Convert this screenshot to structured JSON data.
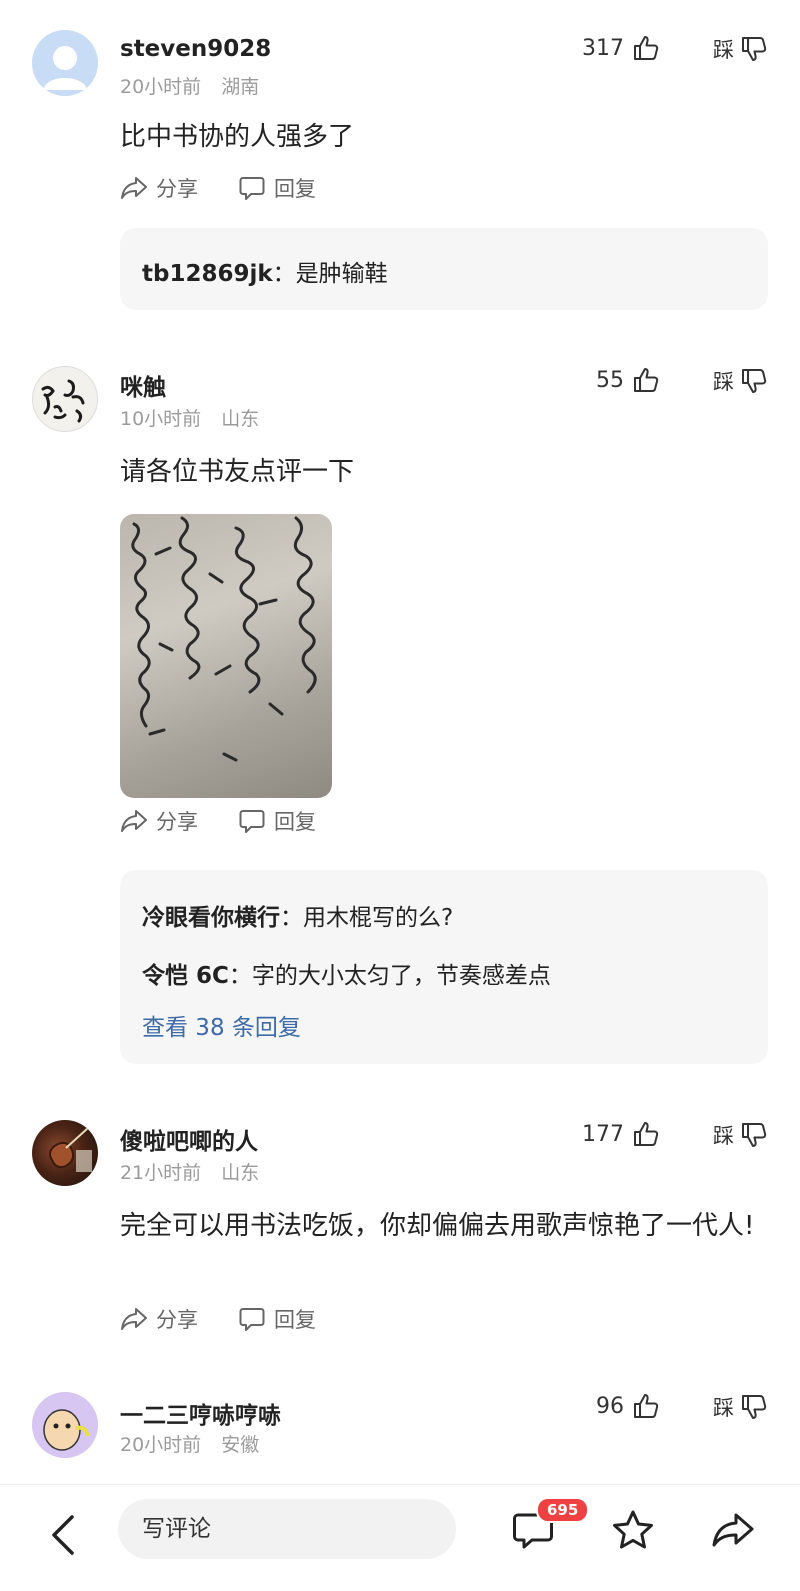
{
  "comments": [
    {
      "username": "steven9028",
      "time": "20小时前",
      "location": "湖南",
      "likes": "317",
      "dislike_label": "踩",
      "text": "比中书协的人强多了",
      "share_label": "分享",
      "reply_label": "回复",
      "replies": [
        {
          "name": "tb12869jk",
          "sep": "：",
          "text": "是肿输鞋"
        }
      ]
    },
    {
      "username": "咪触",
      "time": "10小时前",
      "location": "山东",
      "likes": "55",
      "dislike_label": "踩",
      "text": "请各位书友点评一下",
      "share_label": "分享",
      "reply_label": "回复",
      "replies": [
        {
          "name": "冷眼看你横行",
          "sep": "：",
          "text": "用木棍写的么?"
        },
        {
          "name": "令恺 6C",
          "sep": "：",
          "text": "字的大小太匀了，节奏感差点"
        }
      ],
      "view_more": "查看 38 条回复"
    },
    {
      "username": "傻啦吧唧的人",
      "time": "21小时前",
      "location": "山东",
      "likes": "177",
      "dislike_label": "踩",
      "text": "完全可以用书法吃饭，你却偏偏去用歌声惊艳了一代人!",
      "share_label": "分享",
      "reply_label": "回复"
    },
    {
      "username": "一二三哼哧哼哧",
      "time": "20小时前",
      "location": "安徽",
      "likes": "96",
      "dislike_label": "踩"
    }
  ],
  "bottom_bar": {
    "input_placeholder": "写评论",
    "comment_count_badge": "695"
  },
  "colors": {
    "link_blue": "#3d6aa8",
    "badge_red": "#f04142",
    "meta_gray": "#9b9b9b",
    "reply_bg": "#f6f6f6"
  }
}
